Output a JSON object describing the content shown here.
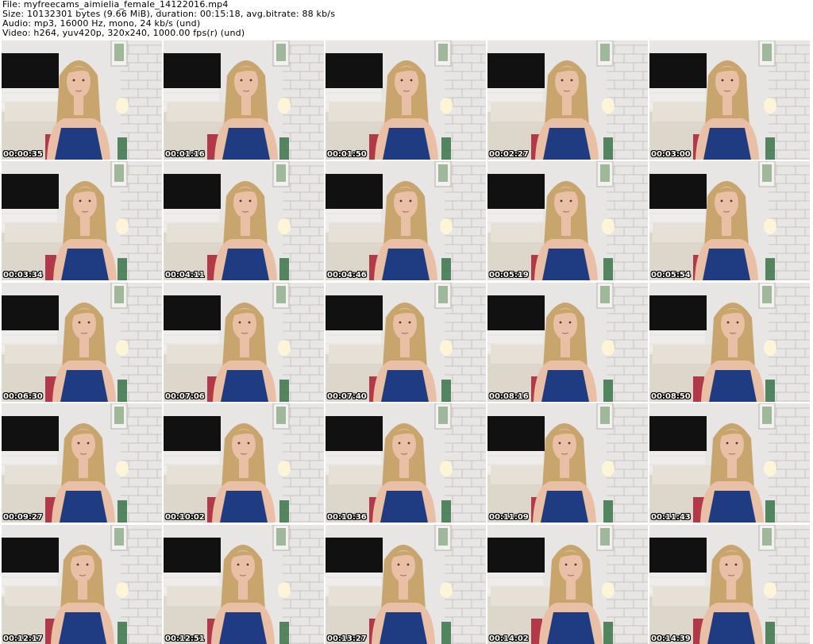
{
  "header": {
    "file_line": "File: myfreecams_aimielia_female_14122016.mp4",
    "size_line": "Size: 10132301 bytes (9.66 MiB), duration: 00:15:18, avg.bitrate: 88 kb/s",
    "audio_line": "Audio: mp3, 16000 Hz, mono, 24 kb/s (und)",
    "video_line": "Video: h264, yuv420p, 320x240, 1000.00 fps(r) (und)"
  },
  "colors": {
    "wall": "#e8e6e4",
    "brick_line": "#bdb9b6",
    "tv": "#111111",
    "sofa": "#ddd6ca",
    "hair": "#c9a56e",
    "skin": "#e9c0a6",
    "top": "#1f3c82",
    "chair": "#b23a48"
  },
  "thumbnails": [
    {
      "timestamp": "00:00:35"
    },
    {
      "timestamp": "00:01:16"
    },
    {
      "timestamp": "00:01:50"
    },
    {
      "timestamp": "00:02:27"
    },
    {
      "timestamp": "00:03:00"
    },
    {
      "timestamp": "00:03:34"
    },
    {
      "timestamp": "00:04:11"
    },
    {
      "timestamp": "00:04:46"
    },
    {
      "timestamp": "00:05:19"
    },
    {
      "timestamp": "00:05:54"
    },
    {
      "timestamp": "00:06:30"
    },
    {
      "timestamp": "00:07:06"
    },
    {
      "timestamp": "00:07:40"
    },
    {
      "timestamp": "00:08:16"
    },
    {
      "timestamp": "00:08:50"
    },
    {
      "timestamp": "00:09:27"
    },
    {
      "timestamp": "00:10:02"
    },
    {
      "timestamp": "00:10:36"
    },
    {
      "timestamp": "00:11:09"
    },
    {
      "timestamp": "00:11:43"
    },
    {
      "timestamp": "00:12:17"
    },
    {
      "timestamp": "00:12:51"
    },
    {
      "timestamp": "00:13:27"
    },
    {
      "timestamp": "00:14:02"
    },
    {
      "timestamp": "00:14:39"
    }
  ]
}
